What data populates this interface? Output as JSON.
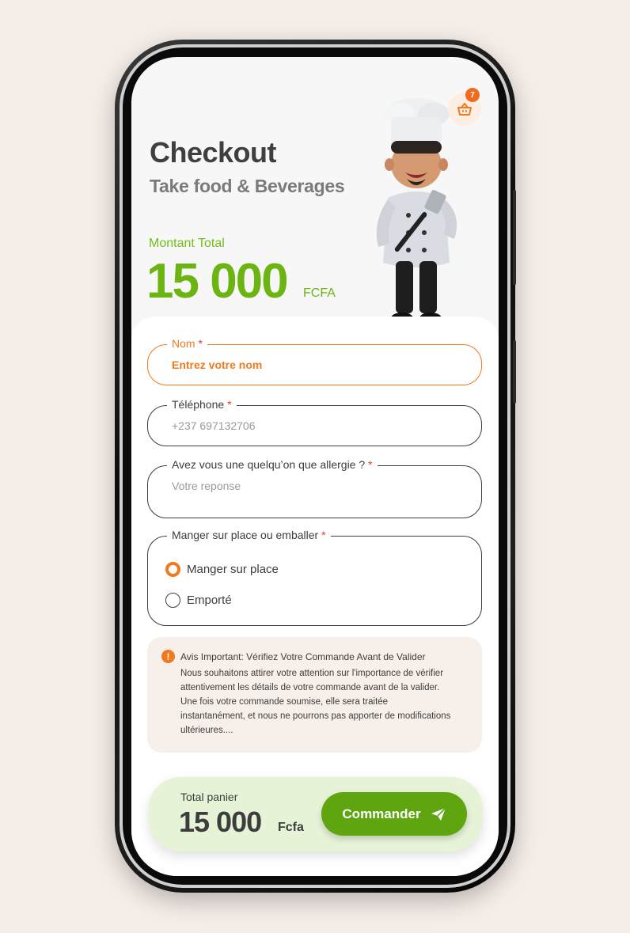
{
  "header": {
    "title": "Checkout",
    "subtitle": "Take food & Beverages",
    "cart_badge": "7",
    "amount_label": "Montant Total",
    "amount_value": "15 000",
    "amount_currency": "FCFA"
  },
  "form": {
    "name": {
      "label": "Nom",
      "required_mark": "*",
      "value": "Entrez votre nom"
    },
    "phone": {
      "label": "Téléphone",
      "required_mark": "*",
      "placeholder": "+237 697132706"
    },
    "allergy": {
      "label": "Avez vous une quelqu’on que  allergie ?",
      "required_mark": "*",
      "placeholder": "Votre reponse"
    },
    "service": {
      "label": "Manger sur place ou emballer",
      "required_mark": "*",
      "options": [
        {
          "label": "Manger sur place",
          "selected": true
        },
        {
          "label": "Emporté",
          "selected": false
        }
      ]
    }
  },
  "notice": {
    "icon": "exclamation-icon",
    "title": "Avis Important: Vérifiez Votre Commande Avant de Valider",
    "body": "Nous souhaitons attirer votre attention sur l'importance de vérifier attentivement les détails de votre commande avant de la valider. Une fois votre commande soumise, elle sera traitée instantanément, et nous ne pourrons pas apporter de modifications ultérieures...."
  },
  "footer": {
    "total_label": "Total panier",
    "total_value": "15 000",
    "total_currency": "Fcfa",
    "order_button": "Commander"
  },
  "colors": {
    "accent_orange": "#f07a1e",
    "accent_green": "#6bb412",
    "button_green": "#5ea50f",
    "background": "#f5ede8"
  }
}
